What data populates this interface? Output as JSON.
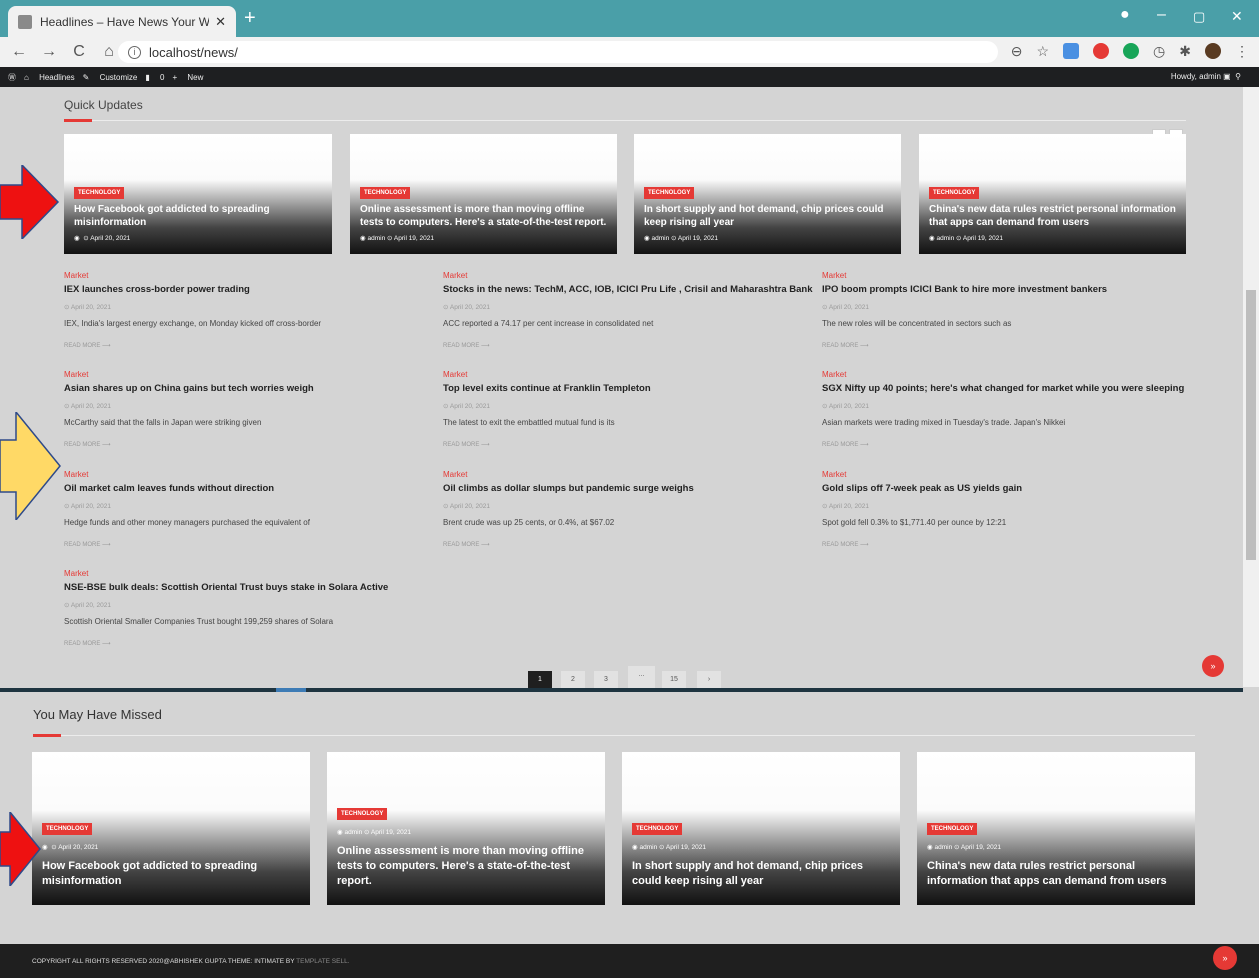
{
  "browser": {
    "tab_title": "Headlines – Have News Your Way",
    "url": "localhost/news/",
    "new_tab": "+",
    "minimize": "–",
    "maximize": "▢",
    "close": "✕"
  },
  "adminbar": {
    "site": "Headlines",
    "customize": "Customize",
    "comments": "0",
    "new": "New",
    "greeting": "Howdy, admin"
  },
  "quick_updates": {
    "title": "Quick Updates",
    "prev": "‹",
    "next": "›",
    "cards": [
      {
        "badge": "TECHNOLOGY",
        "headline": "How Facebook got addicted to spreading misinformation",
        "meta": "⊙ April 20, 2021"
      },
      {
        "badge": "TECHNOLOGY",
        "headline": "Online assessment is more than moving offline tests to computers. Here's a state-of-the-test report.",
        "meta": "admin ⊙ April 19, 2021"
      },
      {
        "badge": "TECHNOLOGY",
        "headline": "In short supply and hot demand, chip prices could keep rising all year",
        "meta": "admin ⊙ April 19, 2021"
      },
      {
        "badge": "TECHNOLOGY",
        "headline": "China's new data rules restrict personal information that apps can demand from users",
        "meta": "admin ⊙ April 19, 2021"
      }
    ]
  },
  "articles": [
    {
      "cat": "Market",
      "title": "IEX launches cross-border power trading",
      "date": "⊙ April 20, 2021",
      "excerpt": "IEX, India's largest energy exchange, on Monday kicked off cross-border",
      "more": "READ MORE ⟶"
    },
    {
      "cat": "Market",
      "title": "Stocks in the news: TechM, ACC, IOB, ICICI Pru Life , Crisil and Maharashtra Bank",
      "date": "⊙ April 20, 2021",
      "excerpt": "ACC reported a 74.17 per cent increase in consolidated net",
      "more": "READ MORE ⟶"
    },
    {
      "cat": "Market",
      "title": "IPO boom prompts ICICI Bank to hire more investment bankers",
      "date": "⊙ April 20, 2021",
      "excerpt": "The new roles will be concentrated in sectors such as",
      "more": "READ MORE ⟶"
    },
    {
      "cat": "Market",
      "title": "Asian shares up on China gains but tech worries weigh",
      "date": "⊙ April 20, 2021",
      "excerpt": "McCarthy said that the falls in Japan were striking given",
      "more": "READ MORE ⟶"
    },
    {
      "cat": "Market",
      "title": "Top level exits continue at Franklin Templeton",
      "date": "⊙ April 20, 2021",
      "excerpt": "The latest to exit the embattled mutual fund is its",
      "more": "READ MORE ⟶"
    },
    {
      "cat": "Market",
      "title": "SGX Nifty up 40 points; here's what changed for market while you were sleeping",
      "date": "⊙ April 20, 2021",
      "excerpt": "Asian markets were trading mixed in Tuesday's trade. Japan's Nikkei",
      "more": "READ MORE ⟶"
    },
    {
      "cat": "Market",
      "title": "Oil market calm leaves funds without direction",
      "date": "⊙ April 20, 2021",
      "excerpt": "Hedge funds and other money managers purchased the equivalent of",
      "more": "READ MORE ⟶"
    },
    {
      "cat": "Market",
      "title": "Oil climbs as dollar slumps but pandemic surge weighs",
      "date": "⊙ April 20, 2021",
      "excerpt": "Brent crude was up 25 cents, or 0.4%, at $67.02",
      "more": "READ MORE ⟶"
    },
    {
      "cat": "Market",
      "title": "Gold slips off 7-week peak as US yields gain",
      "date": "⊙ April 20, 2021",
      "excerpt": "Spot gold fell 0.3% to $1,771.40 per ounce by 12:21",
      "more": "READ MORE ⟶"
    },
    {
      "cat": "Market",
      "title": "NSE-BSE bulk deals: Scottish Oriental Trust buys stake in Solara Active",
      "date": "⊙ April 20, 2021",
      "excerpt": "Scottish Oriental Smaller Companies Trust bought 199,259 shares of Solara",
      "more": "READ MORE ⟶"
    }
  ],
  "pagination": [
    "1",
    "2",
    "3",
    "...",
    "15",
    "›"
  ],
  "back_to_top": "»",
  "missed": {
    "title": "You May Have Missed",
    "cards": [
      {
        "badge": "TECHNOLOGY",
        "meta": "⊙ April 20, 2021",
        "headline": "How Facebook got addicted to spreading misinformation"
      },
      {
        "badge": "TECHNOLOGY",
        "meta": "admin ⊙ April 19, 2021",
        "headline": "Online assessment is more than moving offline tests to computers. Here's a state-of-the-test report."
      },
      {
        "badge": "TECHNOLOGY",
        "meta": "admin ⊙ April 19, 2021",
        "headline": "In short supply and hot demand, chip prices could keep rising all year"
      },
      {
        "badge": "TECHNOLOGY",
        "meta": "admin ⊙ April 19, 2021",
        "headline": "China's new data rules restrict personal information that apps can demand from users"
      }
    ]
  },
  "footer": {
    "text": "COPYRIGHT ALL RIGHTS RESERVED 2020@ABHISHEK GUPTA THEME: INTIMATE BY",
    "link": "TEMPLATE SELL."
  },
  "colors": {
    "accent": "#e53935",
    "tabbar": "#4a9fa8",
    "adminbar": "#1e1f21",
    "arrow_red": "#ee1111",
    "arrow_yellow": "#ffd966"
  }
}
